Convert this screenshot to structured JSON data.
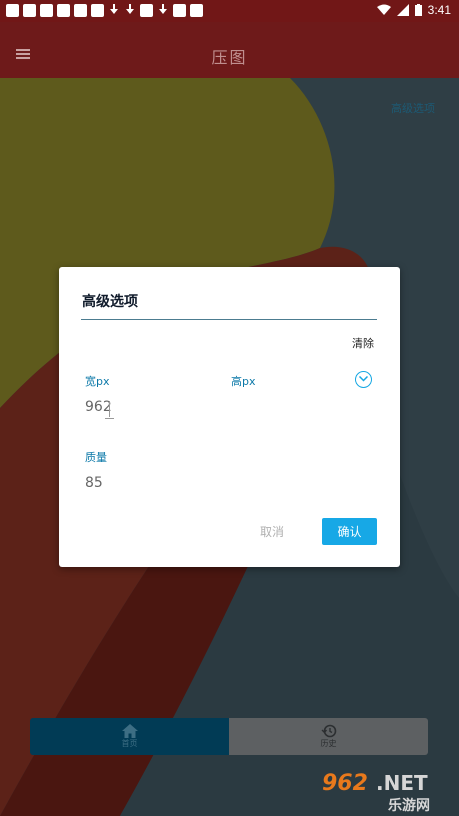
{
  "status_bar": {
    "time": "3:41"
  },
  "app_bar": {
    "title": "压图",
    "menu_icon": "menu-icon"
  },
  "main": {
    "advanced_link": "高级选项"
  },
  "dialog": {
    "title": "高级选项",
    "clear_label": "清除",
    "width_label": "宽px",
    "height_label": "高px",
    "width_value": "962",
    "quality_label": "质量",
    "quality_value": "85",
    "cancel_label": "取消",
    "confirm_label": "确认",
    "expand_icon": "chevron-down-icon"
  },
  "bottom_nav": {
    "items": [
      {
        "label": "首页",
        "icon": "home-icon",
        "active": true
      },
      {
        "label": "历史",
        "icon": "history-icon",
        "active": false
      }
    ]
  },
  "watermark": {
    "text": "962.NET",
    "subtext": "乐游网"
  },
  "colors": {
    "accent": "#17a8e6",
    "appbar": "#6e1a1a",
    "label": "#0b78a8"
  }
}
